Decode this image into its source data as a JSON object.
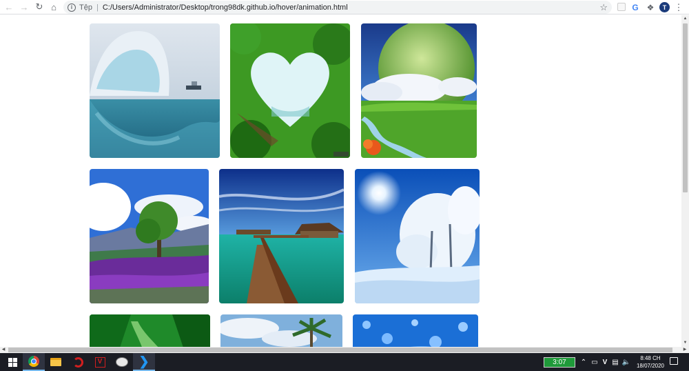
{
  "browser": {
    "back_icon": "back-arrow-icon",
    "forward_icon": "forward-arrow-icon",
    "reload_icon": "reload-icon",
    "home_icon": "home-icon",
    "site_info_label": "Tệp",
    "url": "C:/Users/Administrator/Desktop/trong98dk.github.io/hover/animation.html",
    "bookmark_icon": "star-icon",
    "profile_initial": "T"
  },
  "gallery": {
    "images": [
      {
        "name": "iceberg-underwater"
      },
      {
        "name": "heart-shaped-forest"
      },
      {
        "name": "green-planet-landscape"
      },
      {
        "name": "purple-flowers-tree"
      },
      {
        "name": "tropical-pier-bungalow"
      },
      {
        "name": "snowy-trees-sun"
      },
      {
        "name": "green-waterfall"
      },
      {
        "name": "palm-tree-sky"
      },
      {
        "name": "water-droplets"
      }
    ]
  },
  "taskbar": {
    "apps": [
      "start",
      "chrome",
      "file-explorer",
      "app-red",
      "app-v",
      "app-bird",
      "vscode"
    ],
    "timer": "3:07",
    "ime": "V",
    "time": "8:48 CH",
    "date": "18/07/2020"
  },
  "colors": {
    "timer_bg": "#1f9a3a",
    "taskbar_bg": "#1b1d24",
    "vscode_blue": "#2196f3"
  }
}
